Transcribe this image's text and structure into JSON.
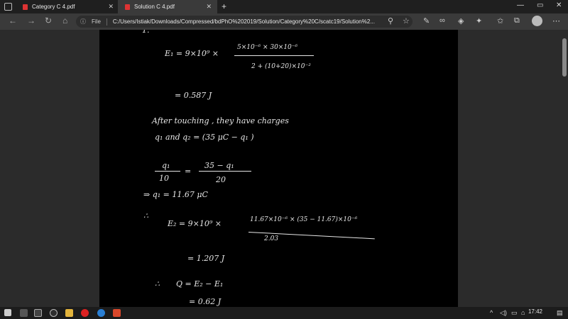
{
  "tabs": [
    {
      "title": "Category C 4.pdf",
      "active": false
    },
    {
      "title": "Solution C 4.pdf",
      "active": true
    }
  ],
  "address": {
    "scheme_label": "File",
    "url": "C:/Users/Istiak/Downloads/Compressed/bdPhO%202019/Solution/Category%20C/scatc19/Solution%2..."
  },
  "document": {
    "line_E1": "E₁ = 9×10⁹ ×",
    "frac1_num": "5×10⁻⁶ × 30×10⁻⁶",
    "frac1_den": "2 + (10+20)×10⁻²",
    "res1": "=  0.587  J",
    "after_line": "After   touching , they  have  charges",
    "q_line": "q₁  and  q₂ = (35 μC − q₁ )",
    "f2_lnum": "q₁",
    "f2_lden": "10",
    "f2_eq": "=",
    "f2_rnum": "35 − q₁",
    "f2_rden": "20",
    "implies": "⇒  q₁ =  11.67  μC",
    "therefore1": "∴",
    "E2_left": "E₂  =   9×10⁹ ×",
    "frac3_num": "11.67×10⁻⁶ × (35 − 11.67)×10⁻⁶",
    "frac3_den": "2.03",
    "res2": "=  1.207  J",
    "therefore2": "∴",
    "Q_line": "Q  =  E₂ − E₁",
    "res3": "=  0.62  J"
  },
  "taskbar": {
    "time": "17:42"
  },
  "colors": {
    "page": "#000000",
    "viewer_bg": "#2b2b2b",
    "tabbar": "#1f1f1f",
    "toolbar": "#3a3a3a",
    "pdf_icon": "#dd3333"
  }
}
